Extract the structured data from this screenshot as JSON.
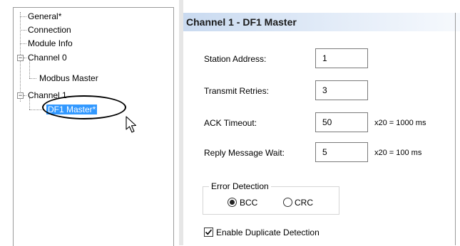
{
  "tree": {
    "items": [
      {
        "label": "General*"
      },
      {
        "label": "Connection"
      },
      {
        "label": "Module Info"
      },
      {
        "label": "Channel 0",
        "expander": "−"
      },
      {
        "label": "Modbus Master"
      },
      {
        "label": "Channel 1",
        "expander": "−"
      },
      {
        "label": "DF1 Master*",
        "selected": true
      }
    ]
  },
  "panel": {
    "title": "Channel 1 - DF1 Master",
    "fields": [
      {
        "label": "Station Address:",
        "value": "1"
      },
      {
        "label": "Transmit Retries:",
        "value": "3"
      },
      {
        "label": "ACK Timeout:",
        "value": "50",
        "unit": "x20 =  1000 ms"
      },
      {
        "label": "Reply Message Wait:",
        "value": "5",
        "unit": "x20 =  100 ms"
      }
    ],
    "error_detection": {
      "title": "Error Detection",
      "options": [
        {
          "label": "BCC",
          "selected": true
        },
        {
          "label": "CRC",
          "selected": false
        }
      ]
    },
    "duplicate_detection": {
      "label": "Enable Duplicate Detection",
      "checked": true
    }
  },
  "colors": {
    "selection": "#3399ff",
    "header_gradient_start": "#c9daf0"
  }
}
